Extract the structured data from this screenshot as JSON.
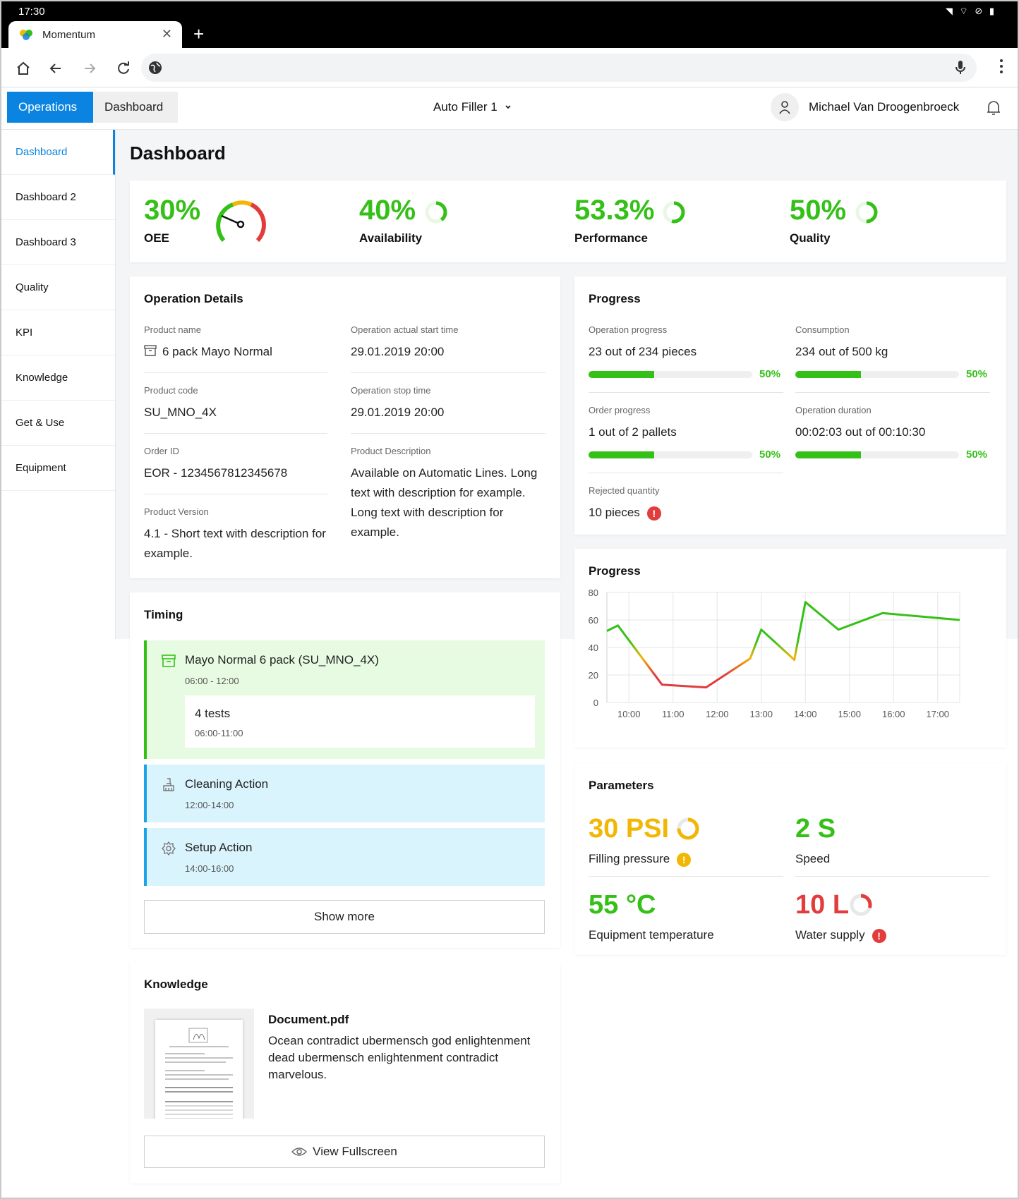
{
  "status": {
    "time": "17:30"
  },
  "browser": {
    "tab_title": "Momentum"
  },
  "header": {
    "tabs": [
      "Operations",
      "Dashboard"
    ],
    "machine": "Auto Filler 1",
    "user": "Michael Van Droogenbroeck"
  },
  "sidebar": {
    "items": [
      {
        "label": "Dashboard"
      },
      {
        "label": "Dashboard 2"
      },
      {
        "label": "Dashboard 3"
      },
      {
        "label": "Quality"
      },
      {
        "label": "KPI"
      },
      {
        "label": "Knowledge"
      },
      {
        "label": "Get & Use"
      },
      {
        "label": "Equipment"
      }
    ]
  },
  "page": {
    "title": "Dashboard"
  },
  "kpis": [
    {
      "value": "30%",
      "label": "OEE",
      "fraction": 0.3
    },
    {
      "value": "40%",
      "label": "Availability",
      "fraction": 0.4
    },
    {
      "value": "53.3%",
      "label": "Performance",
      "fraction": 0.533
    },
    {
      "value": "50%",
      "label": "Quality",
      "fraction": 0.5
    }
  ],
  "colors": {
    "green": "#35c018",
    "blue": "#0a84e0",
    "red": "#e23c3c",
    "yellow": "#f2b705"
  },
  "operation": {
    "title": "Operation Details",
    "product_name_label": "Product name",
    "product_name": "6 pack Mayo Normal",
    "start_label": "Operation actual start time",
    "start": "29.01.2019 20:00",
    "code_label": "Product code",
    "code": "SU_MNO_4X",
    "stop_label": "Operation stop time",
    "stop": "29.01.2019 20:00",
    "order_label": "Order ID",
    "order": "EOR - 1234567812345678",
    "desc_label": "Product Description",
    "desc": "Available on Automatic Lines. Long text with description for example. Long text with description for example.",
    "version_label": "Product Version",
    "version": "4.1 - Short text with description for example."
  },
  "progress": {
    "title": "Progress",
    "items": [
      {
        "label": "Operation progress",
        "value": "23 out of 234 pieces",
        "pct": "50%",
        "fraction": 0.4
      },
      {
        "label": "Consumption",
        "value": "234 out of 500 kg",
        "pct": "50%",
        "fraction": 0.4
      },
      {
        "label": "Order progress",
        "value": "1 out of 2 pallets",
        "pct": "50%",
        "fraction": 0.4
      },
      {
        "label": "Operation duration",
        "value": "00:02:03 out of 00:10:30",
        "pct": "50%",
        "fraction": 0.4
      }
    ],
    "rejected_label": "Rejected quantity",
    "rejected": "10 pieces"
  },
  "chart_data": {
    "type": "line",
    "title": "Progress",
    "x": [
      "09:30",
      "09:45",
      "10:45",
      "11:45",
      "12:45",
      "13:00",
      "13:45",
      "14:00",
      "14:45",
      "15:45",
      "17:30"
    ],
    "values": [
      52,
      56,
      13,
      11,
      32,
      53,
      31,
      73,
      53,
      65,
      60
    ],
    "categories": [
      "10:00",
      "11:00",
      "12:00",
      "13:00",
      "14:00",
      "15:00",
      "16:00",
      "17:00"
    ],
    "yticks": [
      80,
      60,
      40,
      20,
      0
    ],
    "ylim": [
      0,
      80
    ],
    "grid": true
  },
  "timing": {
    "title": "Timing",
    "items": [
      {
        "title": "Mayo Normal 6 pack (SU_MNO_4X)",
        "time": "06:00 - 12:00",
        "sub_title": "4 tests",
        "sub_time": "06:00-11:00"
      },
      {
        "title": "Cleaning Action",
        "time": "12:00-14:00"
      },
      {
        "title": "Setup Action",
        "time": "14:00-16:00"
      }
    ],
    "show_more": "Show more"
  },
  "parameters": {
    "title": "Parameters",
    "items": [
      {
        "value": "30 PSI",
        "label": "Filling pressure",
        "color": "#f2b705",
        "fraction": 0.75
      },
      {
        "value": "2 S",
        "label": "Speed",
        "color": "#35c018"
      },
      {
        "value": "55 °C",
        "label": "Equipment temperature",
        "color": "#35c018"
      },
      {
        "value": "10 L",
        "label": "Water supply",
        "color": "#e23c3c",
        "fraction": 0.3
      }
    ]
  },
  "knowledge": {
    "title": "Knowledge",
    "doc_title": "Document.pdf",
    "doc_desc": "Ocean contradict ubermensch god enlightenment dead ubermensch enlightenment contradict marvelous.",
    "view_btn": "View Fullscreen"
  }
}
